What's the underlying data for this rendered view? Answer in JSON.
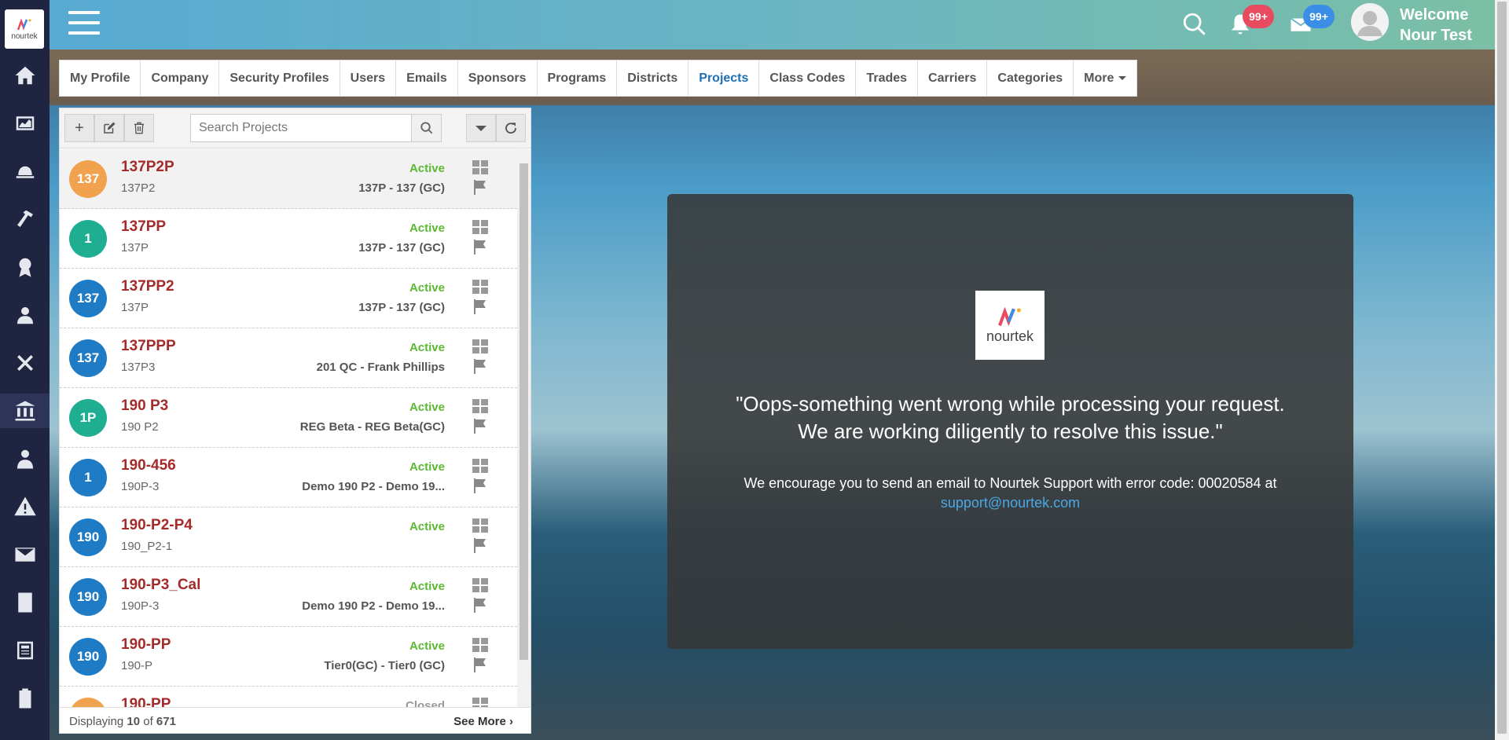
{
  "app": {
    "logo_text": "nourtek"
  },
  "header": {
    "notifications_badge": "99+",
    "messages_badge": "99+",
    "welcome_line1": "Welcome",
    "welcome_line2": "Nour Test"
  },
  "tabs": [
    {
      "label": "My Profile"
    },
    {
      "label": "Company"
    },
    {
      "label": "Security Profiles"
    },
    {
      "label": "Users"
    },
    {
      "label": "Emails"
    },
    {
      "label": "Sponsors"
    },
    {
      "label": "Programs"
    },
    {
      "label": "Districts"
    },
    {
      "label": "Projects"
    },
    {
      "label": "Class Codes"
    },
    {
      "label": "Trades"
    },
    {
      "label": "Carriers"
    },
    {
      "label": "Categories"
    },
    {
      "label": "More"
    }
  ],
  "search": {
    "placeholder": "Search Projects"
  },
  "projects": [
    {
      "badge": "137",
      "title": "137P2P",
      "sub": "137P2",
      "status": "Active",
      "desc": "137P - 137 (GC)",
      "color": "#f0a24f"
    },
    {
      "badge": "1",
      "title": "137PP",
      "sub": "137P",
      "status": "Active",
      "desc": "137P - 137 (GC)",
      "color": "#1fae92"
    },
    {
      "badge": "137",
      "title": "137PP2",
      "sub": "137P",
      "status": "Active",
      "desc": "137P - 137 (GC)",
      "color": "#1f7bc4"
    },
    {
      "badge": "137",
      "title": "137PPP",
      "sub": "137P3",
      "status": "Active",
      "desc": "201 QC - Frank Phillips",
      "color": "#1f7bc4"
    },
    {
      "badge": "1P",
      "title": "190 P3",
      "sub": "190 P2",
      "status": "Active",
      "desc": "REG Beta - REG Beta(GC)",
      "color": "#1fae92"
    },
    {
      "badge": "1",
      "title": "190-456",
      "sub": "190P-3",
      "status": "Active",
      "desc": "Demo 190 P2 - Demo 19...",
      "color": "#1f7bc4"
    },
    {
      "badge": "190",
      "title": "190-P2-P4",
      "sub": "190_P2-1",
      "status": "Active",
      "desc": "",
      "color": "#1f7bc4"
    },
    {
      "badge": "190",
      "title": "190-P3_Cal",
      "sub": "190P-3",
      "status": "Active",
      "desc": "Demo 190 P2 - Demo 19...",
      "color": "#1f7bc4"
    },
    {
      "badge": "190",
      "title": "190-PP",
      "sub": "190-P",
      "status": "Active",
      "desc": "Tier0(GC) - Tier0 (GC)",
      "color": "#1f7bc4"
    },
    {
      "badge": "",
      "title": "190-PP",
      "sub": "",
      "status": "Closed",
      "desc": "",
      "color": "#f0a24f"
    }
  ],
  "footer": {
    "displaying": "Displaying",
    "count": "10",
    "of": "of",
    "total": "671",
    "see_more": "See More"
  },
  "error": {
    "logo_text": "nourtek",
    "quote_line1": "\"Oops-something went wrong while processing your request.",
    "quote_line2": "We are working diligently to resolve this issue.\"",
    "text": "We encourage you to send an email to Nourtek Support with error code: 00020584 at",
    "email": "support@nourtek.com"
  }
}
